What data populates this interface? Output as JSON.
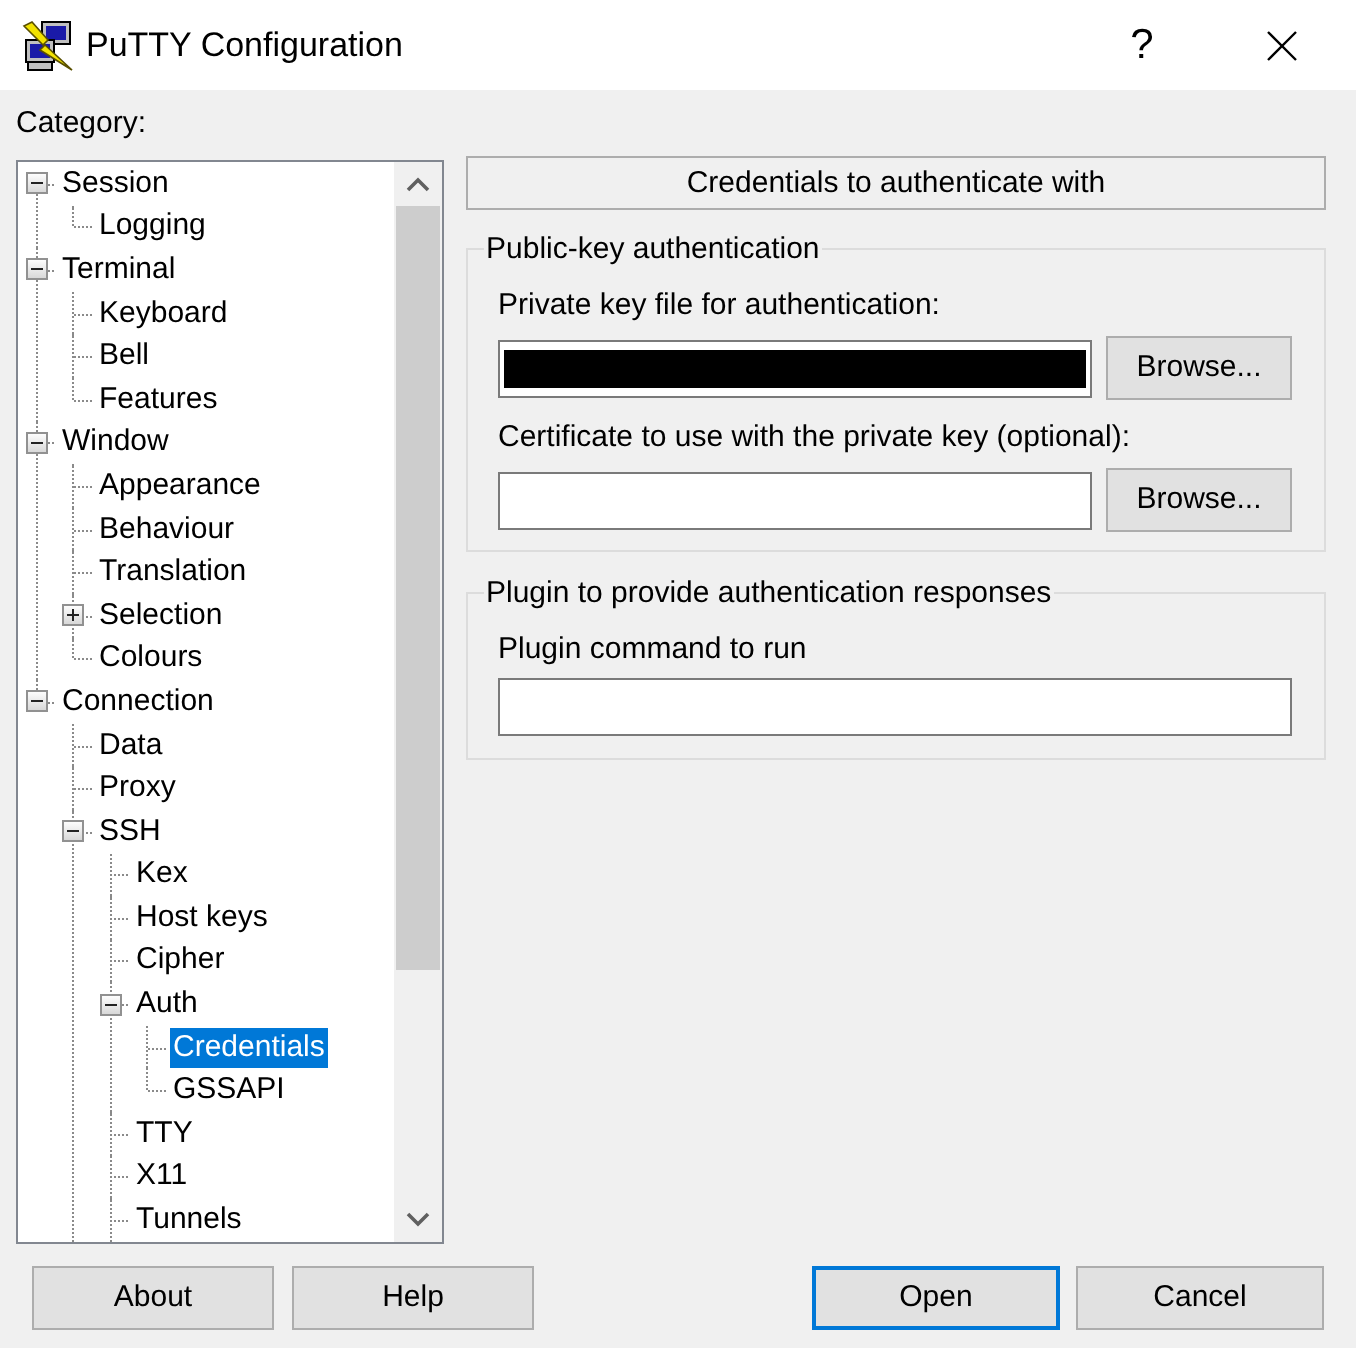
{
  "window": {
    "title": "PuTTY Configuration",
    "help_button": "?"
  },
  "category": {
    "label": "Category:",
    "more_below": true,
    "tree": [
      {
        "label": "Session",
        "expanded": true,
        "selected": false,
        "children": [
          {
            "label": "Logging",
            "selected": false
          }
        ]
      },
      {
        "label": "Terminal",
        "expanded": true,
        "selected": false,
        "children": [
          {
            "label": "Keyboard",
            "selected": false
          },
          {
            "label": "Bell",
            "selected": false
          },
          {
            "label": "Features",
            "selected": false
          }
        ]
      },
      {
        "label": "Window",
        "expanded": true,
        "selected": false,
        "children": [
          {
            "label": "Appearance",
            "selected": false
          },
          {
            "label": "Behaviour",
            "selected": false
          },
          {
            "label": "Translation",
            "selected": false
          },
          {
            "label": "Selection",
            "expanded": false,
            "selected": false
          },
          {
            "label": "Colours",
            "selected": false
          }
        ]
      },
      {
        "label": "Connection",
        "expanded": true,
        "selected": false,
        "children": [
          {
            "label": "Data",
            "selected": false
          },
          {
            "label": "Proxy",
            "selected": false
          },
          {
            "label": "SSH",
            "expanded": true,
            "selected": false,
            "children": [
              {
                "label": "Kex",
                "selected": false
              },
              {
                "label": "Host keys",
                "selected": false
              },
              {
                "label": "Cipher",
                "selected": false
              },
              {
                "label": "Auth",
                "expanded": true,
                "selected": false,
                "children": [
                  {
                    "label": "Credentials",
                    "selected": true
                  },
                  {
                    "label": "GSSAPI",
                    "selected": false
                  }
                ]
              },
              {
                "label": "TTY",
                "selected": false
              },
              {
                "label": "X11",
                "selected": false
              },
              {
                "label": "Tunnels",
                "selected": false
              }
            ]
          }
        ]
      }
    ]
  },
  "panel": {
    "title": "Credentials to authenticate with",
    "groups": [
      {
        "legend": "Public-key authentication",
        "fields": [
          {
            "label": "Private key file for authentication:",
            "redacted": true,
            "browse_button": "Browse..."
          },
          {
            "label": "Certificate to use with the private key (optional):",
            "redacted": false,
            "browse_button": "Browse..."
          }
        ]
      },
      {
        "legend": "Plugin to provide authentication responses",
        "fields": [
          {
            "label": "Plugin command to run",
            "redacted": false
          }
        ]
      }
    ]
  },
  "buttons_left": [
    {
      "label": "About",
      "focused": false
    },
    {
      "label": "Help",
      "focused": false
    }
  ],
  "buttons_right": [
    {
      "label": "Open",
      "focused": true
    },
    {
      "label": "Cancel",
      "focused": false
    }
  ]
}
